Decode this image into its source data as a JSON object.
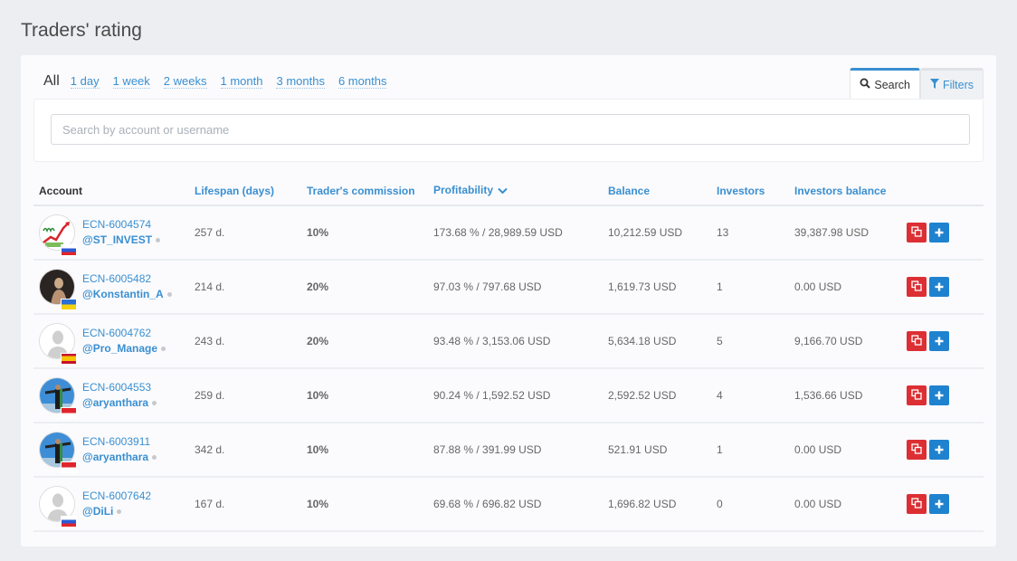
{
  "page": {
    "title": "Traders' rating"
  },
  "periods": {
    "active": "All",
    "links": [
      "1 day",
      "1 week",
      "2 weeks",
      "1 month",
      "3 months",
      "6 months"
    ]
  },
  "tabs": [
    {
      "label": "Search",
      "icon": "search-icon",
      "active": true
    },
    {
      "label": "Filters",
      "icon": "filter-icon",
      "active": false
    }
  ],
  "search": {
    "value": "",
    "placeholder": "Search by account or username"
  },
  "table": {
    "columns": [
      {
        "label": "Account"
      },
      {
        "label": "Lifespan (days)"
      },
      {
        "label": "Trader's commission"
      },
      {
        "label": "Profitability",
        "sorted": "desc",
        "sort_icon": "chevron-down-icon"
      },
      {
        "label": "Balance"
      },
      {
        "label": "Investors"
      },
      {
        "label": "Investors balance"
      },
      {
        "label": ""
      }
    ],
    "rows": [
      {
        "account": "ECN-6004574",
        "username": "@ST_INVEST",
        "avatar": "chart-logo",
        "flag": "russia",
        "lifespan": "257 d.",
        "commission": "10%",
        "profitability": "173.68 % / 28,989.59 USD",
        "balance": "10,212.59 USD",
        "investors": "13",
        "investors_balance": "39,387.98 USD"
      },
      {
        "account": "ECN-6005482",
        "username": "@Konstantin_A",
        "avatar": "photo-dark",
        "flag": "ukraine",
        "lifespan": "214 d.",
        "commission": "20%",
        "profitability": "97.03 % / 797.68 USD",
        "balance": "1,619.73 USD",
        "investors": "1",
        "investors_balance": "0.00 USD"
      },
      {
        "account": "ECN-6004762",
        "username": "@Pro_Manage",
        "avatar": "default-user",
        "flag": "spain",
        "lifespan": "243 d.",
        "commission": "20%",
        "profitability": "93.48 % / 3,153.06 USD",
        "balance": "5,634.18 USD",
        "investors": "5",
        "investors_balance": "9,166.70 USD"
      },
      {
        "account": "ECN-6004553",
        "username": "@aryanthara",
        "avatar": "photo-sky",
        "flag": "indonesia",
        "lifespan": "259 d.",
        "commission": "10%",
        "profitability": "90.24 % / 1,592.52 USD",
        "balance": "2,592.52 USD",
        "investors": "4",
        "investors_balance": "1,536.66 USD"
      },
      {
        "account": "ECN-6003911",
        "username": "@aryanthara",
        "avatar": "photo-sky",
        "flag": "indonesia",
        "lifespan": "342 d.",
        "commission": "10%",
        "profitability": "87.88 % / 391.99 USD",
        "balance": "521.91 USD",
        "investors": "1",
        "investors_balance": "0.00 USD"
      },
      {
        "account": "ECN-6007642",
        "username": "@DiLi",
        "avatar": "default-user",
        "flag": "russia",
        "lifespan": "167 d.",
        "commission": "10%",
        "profitability": "69.68 % / 696.82 USD",
        "balance": "1,696.82 USD",
        "investors": "0",
        "investors_balance": "0.00 USD"
      }
    ]
  },
  "colors": {
    "link": "#3a8fd0",
    "copy_button": "#dc2f34",
    "invest_button": "#1f82cf",
    "profit": "#5a8f3a"
  }
}
